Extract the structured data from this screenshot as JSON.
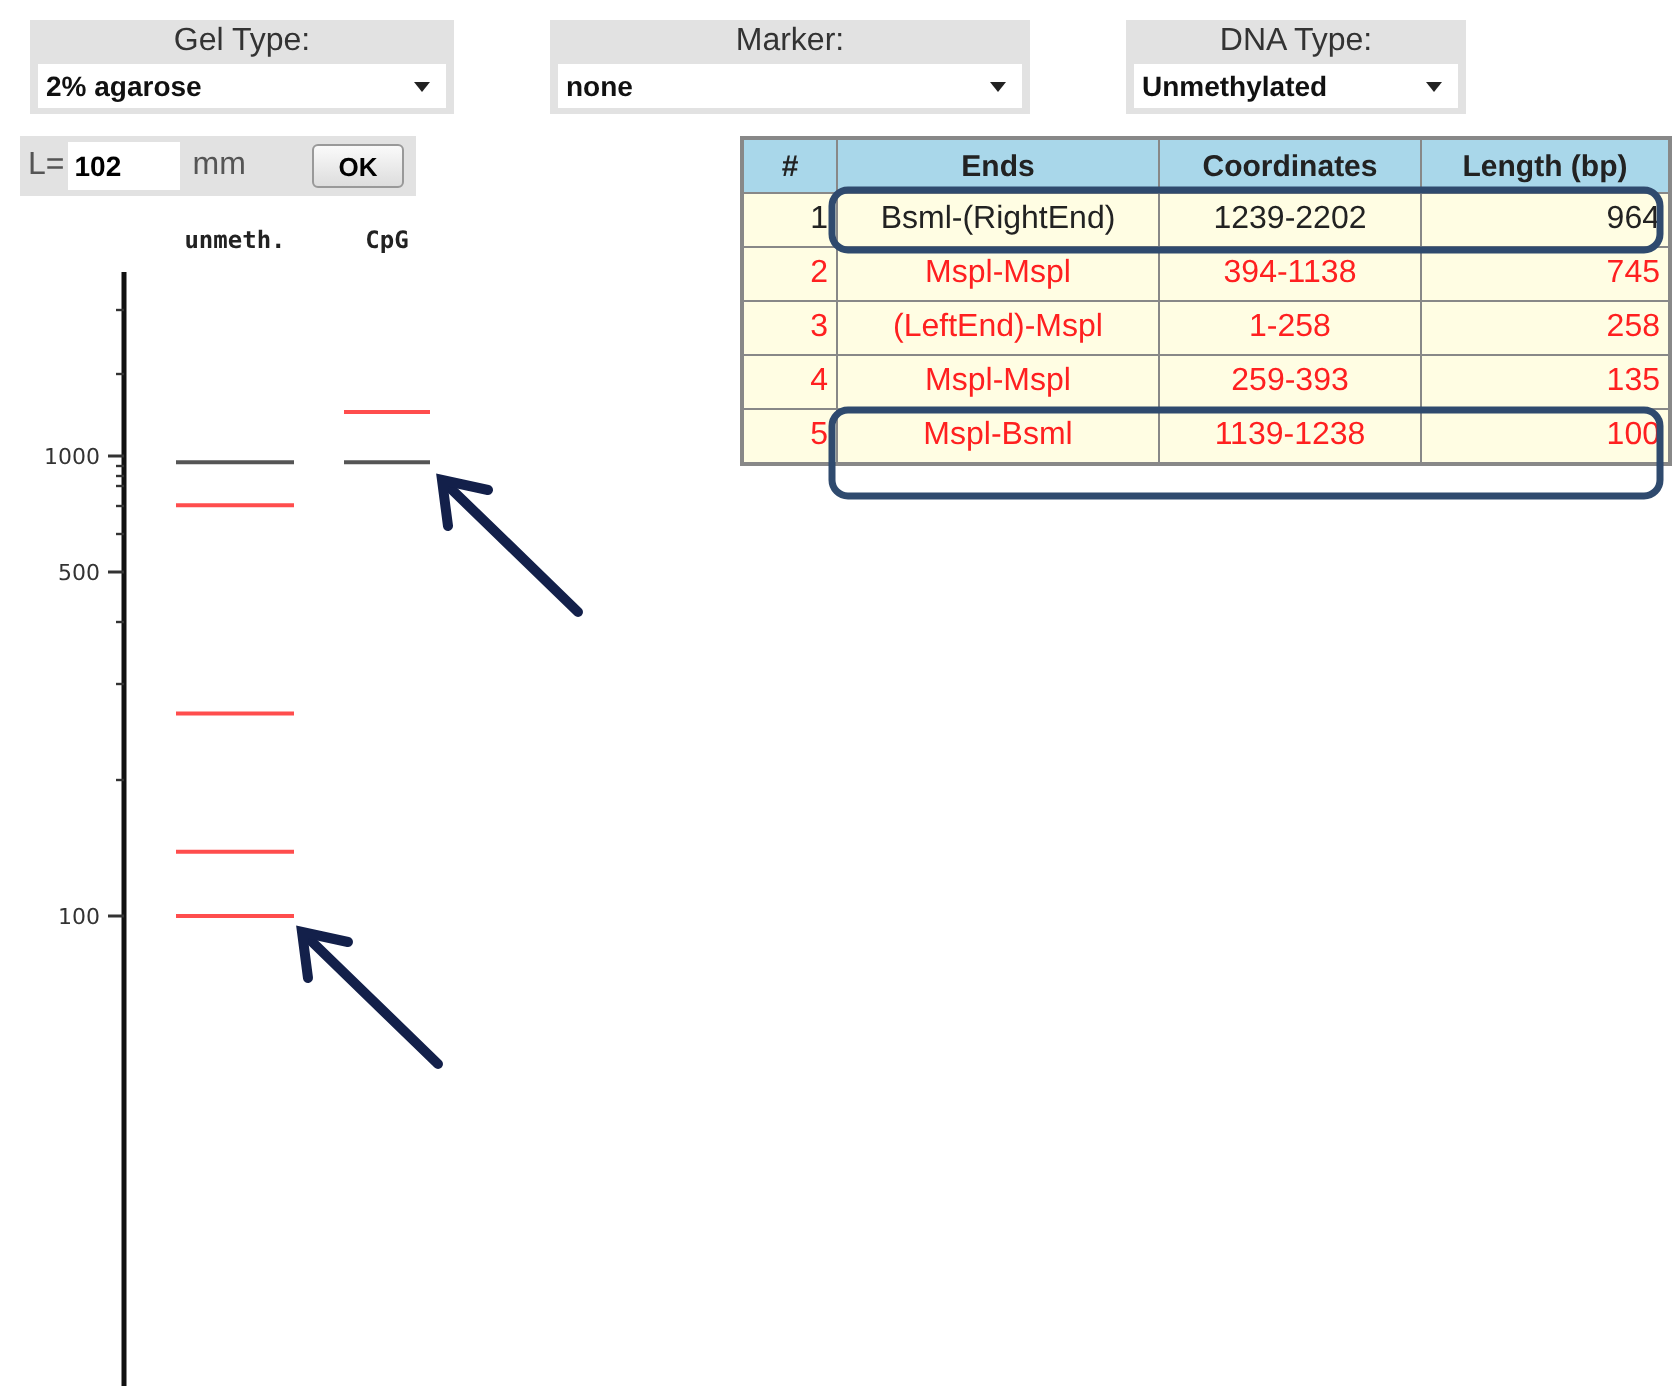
{
  "controls": [
    {
      "label": "Gel Type:",
      "value": "2% agarose"
    },
    {
      "label": "Marker:",
      "value": "none"
    },
    {
      "label": "DNA Type:",
      "value": "Unmethylated"
    }
  ],
  "length_field": {
    "prefix": "L=",
    "value": "102",
    "unit": "mm",
    "button": "OK"
  },
  "gel": {
    "lanes": [
      {
        "label": "unmeth."
      },
      {
        "label": "CpG"
      }
    ],
    "axis_labels": [
      "1000",
      "500",
      "100"
    ]
  },
  "table": {
    "columns": [
      "#",
      "Ends",
      "Coordinates",
      "Length (bp)"
    ],
    "rows": [
      {
        "cells": [
          "1",
          "Bsml-(RightEnd)",
          "1239-2202",
          "964"
        ],
        "color": "#222222"
      },
      {
        "cells": [
          "2",
          "Mspl-Mspl",
          "394-1138",
          "745"
        ],
        "color": "#ff2020"
      },
      {
        "cells": [
          "3",
          "(LeftEnd)-Mspl",
          "1-258",
          "258"
        ],
        "color": "#ff2020"
      },
      {
        "cells": [
          "4",
          "Mspl-Mspl",
          "259-393",
          "135"
        ],
        "color": "#ff2020"
      },
      {
        "cells": [
          "5",
          "Mspl-Bsml",
          "1139-1238",
          "100"
        ],
        "color": "#ff2020"
      }
    ]
  }
}
